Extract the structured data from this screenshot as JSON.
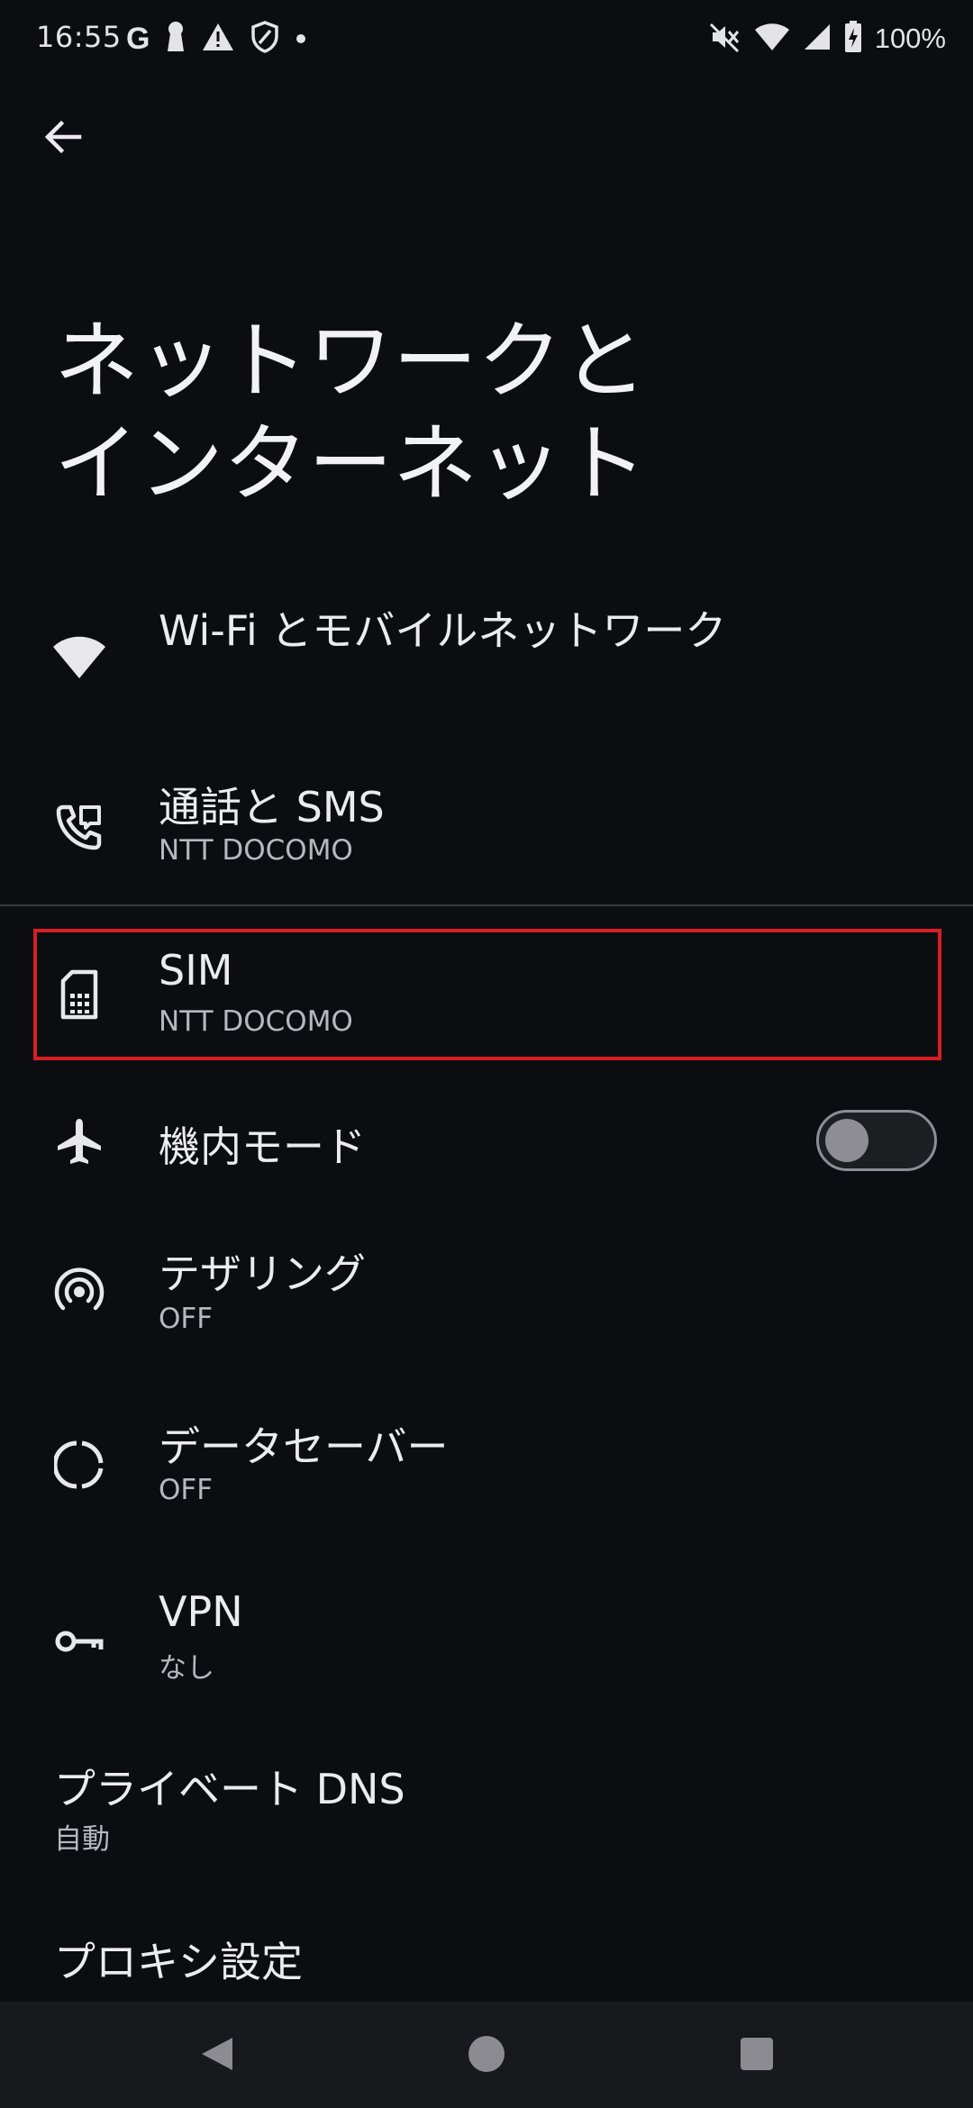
{
  "status_bar": {
    "time": "16:55",
    "google_letter": "G",
    "battery_percent": "100%",
    "left_icons": [
      "google-icon",
      "keyhole-icon",
      "warning-icon",
      "shield-icon",
      "dot-icon"
    ],
    "right_icons": [
      "mute-icon",
      "wifi-icon",
      "cell-signal-icon",
      "battery-charging-icon"
    ]
  },
  "header": {
    "back_icon": "arrow-left-icon",
    "title_line1": "ネットワークと",
    "title_line2": "インターネット"
  },
  "items": [
    {
      "id": "wifi",
      "icon": "wifi-icon",
      "title": "Wi-Fi とモバイルネットワーク",
      "subtitle": ""
    },
    {
      "id": "calls-sms",
      "icon": "phone-sms-icon",
      "title": "通話と SMS",
      "subtitle": "NTT DOCOMO"
    },
    {
      "id": "sim",
      "icon": "sim-card-icon",
      "title": "SIM",
      "subtitle": "NTT DOCOMO"
    },
    {
      "id": "airplane",
      "icon": "airplane-icon",
      "title": "機内モード",
      "subtitle": "",
      "toggle": false
    },
    {
      "id": "tethering",
      "icon": "hotspot-icon",
      "title": "テザリング",
      "subtitle": "OFF"
    },
    {
      "id": "data-saver",
      "icon": "data-saver-icon",
      "title": "データセーバー",
      "subtitle": "OFF"
    },
    {
      "id": "vpn",
      "icon": "key-icon",
      "title": "VPN",
      "subtitle": "なし"
    },
    {
      "id": "private-dns",
      "icon": "",
      "title": "プライベート DNS",
      "subtitle": "自動"
    },
    {
      "id": "proxy",
      "icon": "",
      "title": "プロキシ設定",
      "subtitle": ""
    }
  ],
  "colors": {
    "background": "#0c0d10",
    "text_primary": "#ecebf0",
    "text_secondary": "#b8b7be",
    "highlight": "#d71e25",
    "toggle_off": "#8e8d95",
    "nav_bar": "#18191c"
  },
  "nav_bar": {
    "icons": [
      "back-triangle-icon",
      "home-circle-icon",
      "recents-square-icon"
    ]
  }
}
